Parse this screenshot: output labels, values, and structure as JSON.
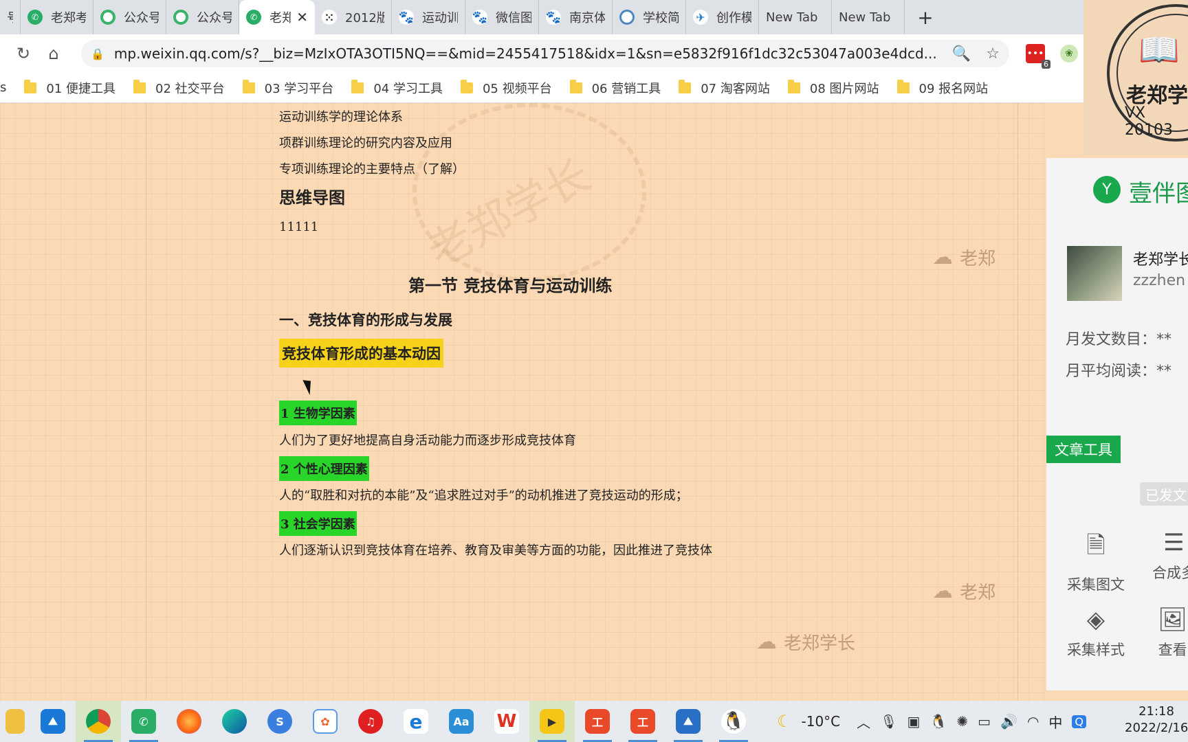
{
  "browser": {
    "tabs": [
      {
        "label": "号",
        "icon": "partial"
      },
      {
        "label": "老郑考",
        "icon": "wechat-icon"
      },
      {
        "label": "公众号",
        "icon": "gzh-icon"
      },
      {
        "label": "公众号",
        "icon": "gzh-icon"
      },
      {
        "label": "老郑",
        "icon": "wechat-icon",
        "active": true,
        "close": "✕"
      },
      {
        "label": "2012版",
        "icon": "dots-icon"
      },
      {
        "label": "运动训",
        "icon": "baidu-icon"
      },
      {
        "label": "微信图",
        "icon": "baidu-icon"
      },
      {
        "label": "南京体",
        "icon": "baidu-icon"
      },
      {
        "label": "学校简",
        "icon": "ring-icon"
      },
      {
        "label": "创作模",
        "icon": "bird-icon"
      },
      {
        "label": "New Tab",
        "icon": ""
      },
      {
        "label": "New Tab",
        "icon": ""
      }
    ],
    "new_tab_symbol": "+",
    "url": "mp.weixin.qq.com/s?__biz=MzIxOTA3OTI5NQ==&mid=2455417518&idx=1&sn=e5832f916f1dc32c53047a003e4dcd...",
    "extension_badge": "6",
    "bookmarks": [
      {
        "label": "s"
      },
      {
        "label": "01 便捷工具"
      },
      {
        "label": "02 社交平台"
      },
      {
        "label": "03 学习平台"
      },
      {
        "label": "04 学习工具"
      },
      {
        "label": "05 视频平台"
      },
      {
        "label": "06 营销工具"
      },
      {
        "label": "07 淘客网站"
      },
      {
        "label": "08 图片网站"
      },
      {
        "label": "09 报名网站"
      }
    ]
  },
  "logo": {
    "line1": "老郑学",
    "line2": "VX 20103"
  },
  "article": {
    "outline": [
      "运动训练学的理论体系",
      "项群训练理论的研究内容及应用",
      "专项训练理论的主要特点（了解）"
    ],
    "mindmap_heading": "思维导图",
    "mindmap_placeholder": "11111",
    "section_title": "第一节  竞技体育与运动训练",
    "subheading": "一、竞技体育的形成与发展",
    "highlight_yellow": "竞技体育形成的基本动因",
    "factors": [
      {
        "title": "1 生物学因素",
        "text": "人们为了更好地提高自身活动能力而逐步形成竞技体育"
      },
      {
        "title": "2 个性心理因素",
        "text": "人的“取胜和对抗的本能”及“追求胜过对手”的动机推进了竞技运动的形成；"
      },
      {
        "title": "3 社会学因素",
        "text": "人们逐渐认识到竞技体育在培养、教育及审美等方面的功能，因此推进了竞技体"
      }
    ],
    "watermark_big": "老郑学长",
    "watermark_small": "老郑学长",
    "watermark_edge": "老郑"
  },
  "panel": {
    "title": "壹伴图",
    "username": "老郑学长",
    "user_id": "zzzhen",
    "stats": [
      {
        "label": "月发文数目：",
        "value": "**"
      },
      {
        "label": "月平均阅读：",
        "value": "**"
      }
    ],
    "tools_button": "文章工具",
    "sent_badge": "已发文",
    "tools": [
      {
        "label": "采集图文"
      },
      {
        "label": "合成多"
      },
      {
        "label": "采集样式"
      },
      {
        "label": "查看"
      }
    ]
  },
  "taskbar": {
    "weather": "-10°C",
    "ime": "中",
    "time": "21:18",
    "date": "2022/2/16"
  }
}
